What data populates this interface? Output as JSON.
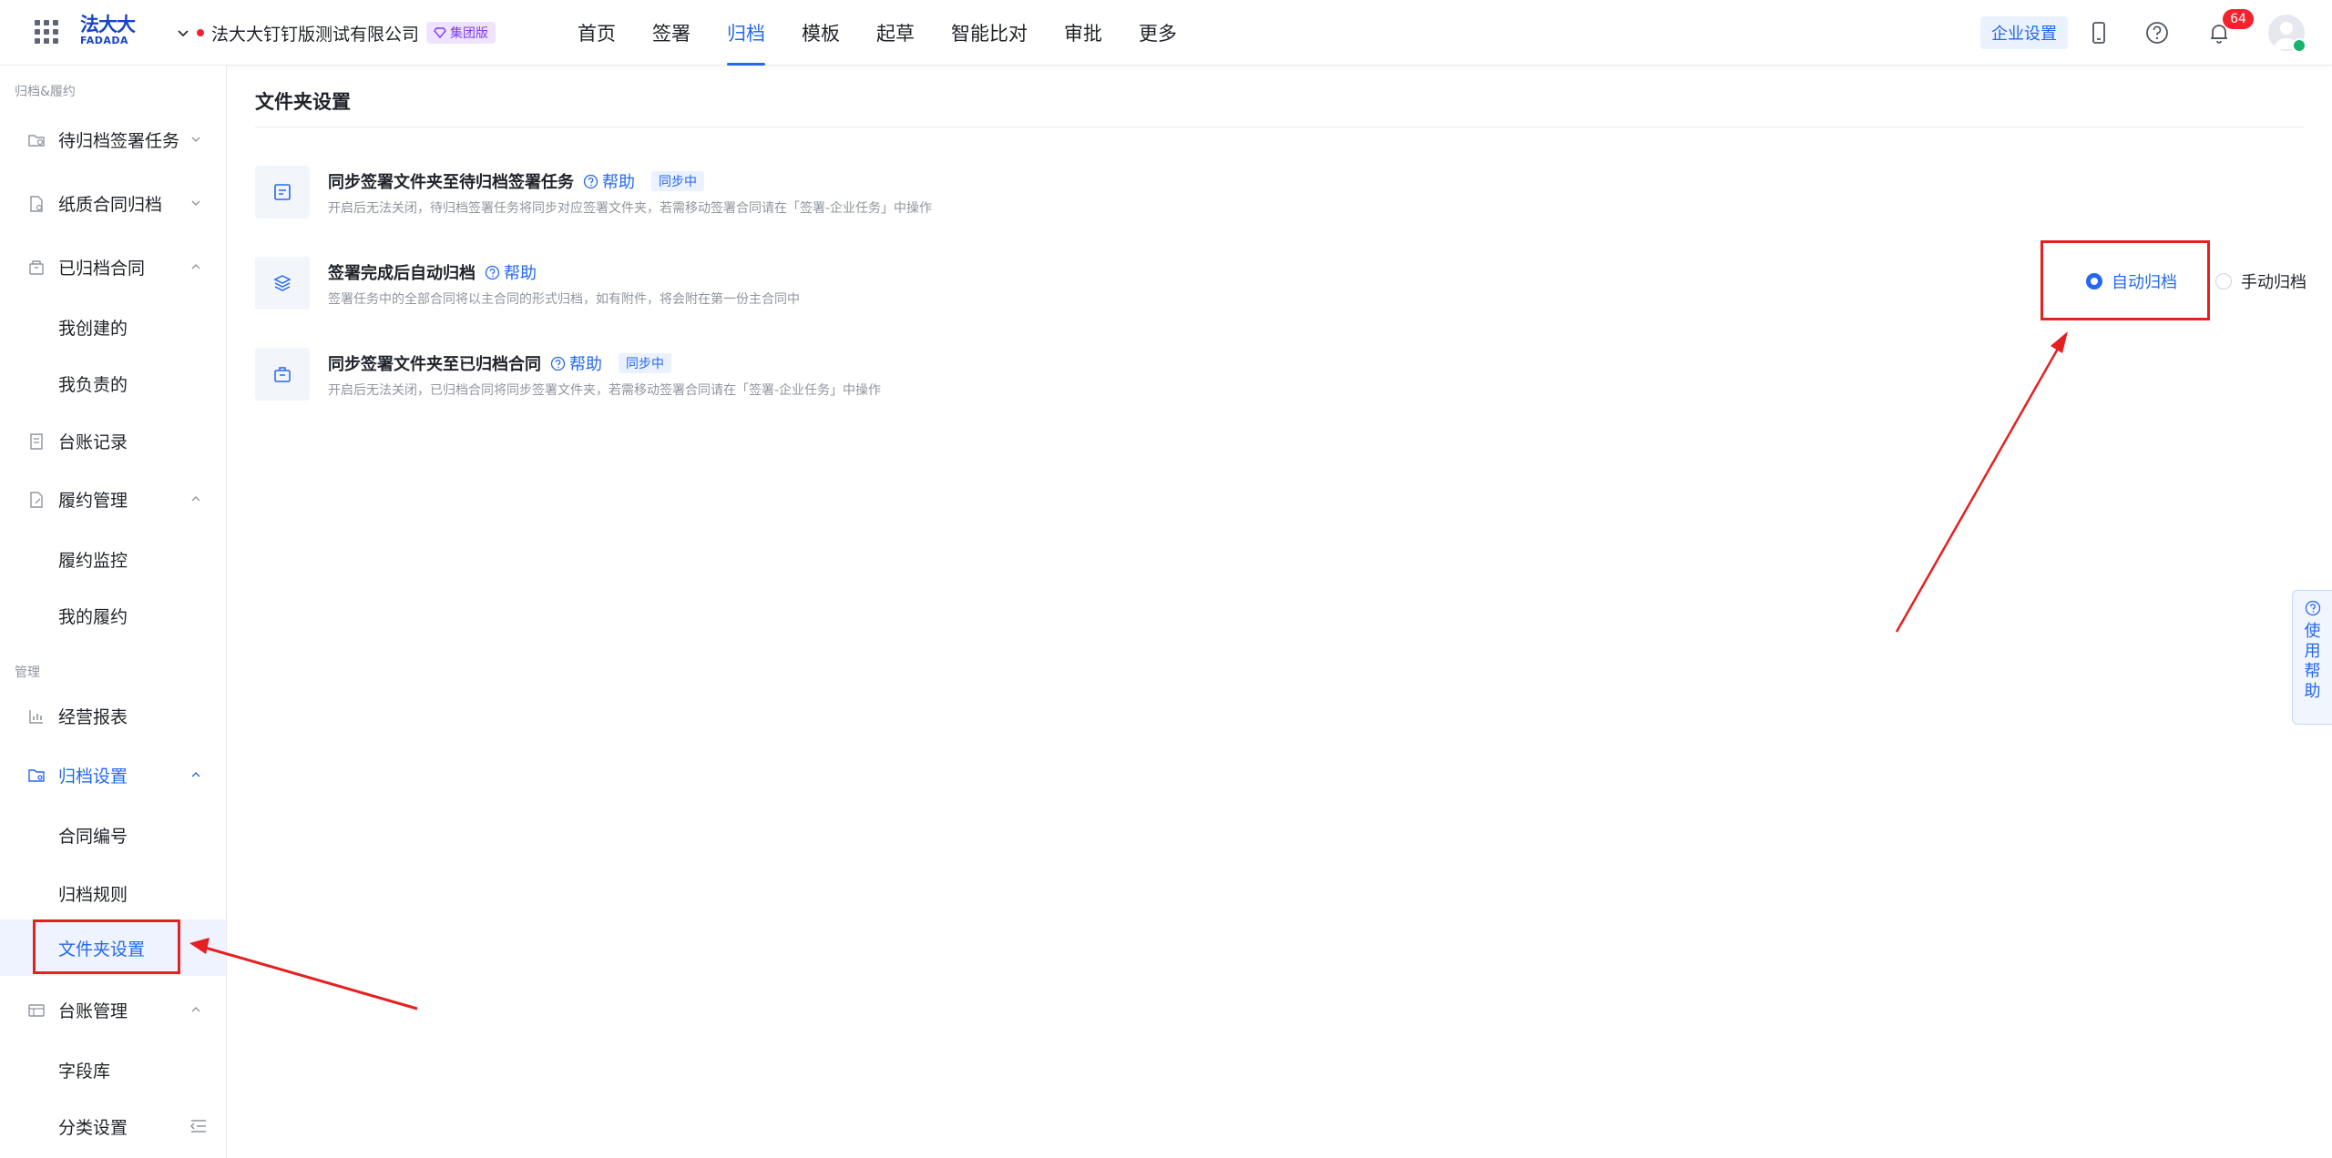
{
  "header": {
    "logo_cn": "法大大",
    "logo_en": "FADADA",
    "company": "法大大钉钉版测试有限公司",
    "edition": "集团版",
    "nav": [
      {
        "label": "首页"
      },
      {
        "label": "签署"
      },
      {
        "label": "归档",
        "active": true
      },
      {
        "label": "模板"
      },
      {
        "label": "起草"
      },
      {
        "label": "智能比对"
      },
      {
        "label": "审批"
      },
      {
        "label": "更多"
      }
    ],
    "enterprise_settings": "企业设置",
    "notification_count": "64"
  },
  "sidebar": {
    "group1": "归档&履约",
    "group2": "管理",
    "items": [
      {
        "label": "待归档签署任务"
      },
      {
        "label": "纸质合同归档"
      },
      {
        "label": "已归档合同"
      },
      {
        "label": "我创建的"
      },
      {
        "label": "我负责的"
      },
      {
        "label": "台账记录"
      },
      {
        "label": "履约管理"
      },
      {
        "label": "履约监控"
      },
      {
        "label": "我的履约"
      },
      {
        "label": "经营报表"
      },
      {
        "label": "归档设置"
      },
      {
        "label": "合同编号"
      },
      {
        "label": "归档规则"
      },
      {
        "label": "文件夹设置"
      },
      {
        "label": "台账管理"
      },
      {
        "label": "字段库"
      },
      {
        "label": "分类设置"
      }
    ]
  },
  "main": {
    "title": "文件夹设置",
    "help_label": "帮助",
    "syncing_tag": "同步中",
    "rows": [
      {
        "title": "同步签署文件夹至待归档签署任务",
        "desc": "开启后无法关闭，待归档签署任务将同步对应签署文件夹，若需移动签署合同请在「签署-企业任务」中操作"
      },
      {
        "title": "签署完成后自动归档",
        "desc": "签署任务中的全部合同将以主合同的形式归档，如有附件，将会附在第一份主合同中"
      },
      {
        "title": "同步签署文件夹至已归档合同",
        "desc": "开启后无法关闭，已归档合同将同步签署文件夹，若需移动签署合同请在「签署-企业任务」中操作"
      }
    ],
    "radio_options": [
      {
        "label": "自动归档",
        "selected": true
      },
      {
        "label": "手动归档",
        "selected": false
      }
    ]
  },
  "floating_help": "使用帮助",
  "colors": {
    "accent": "#2468f2",
    "annotation": "#e52020",
    "edition_bg": "#efe4ff",
    "edition_text": "#7c3aed"
  }
}
